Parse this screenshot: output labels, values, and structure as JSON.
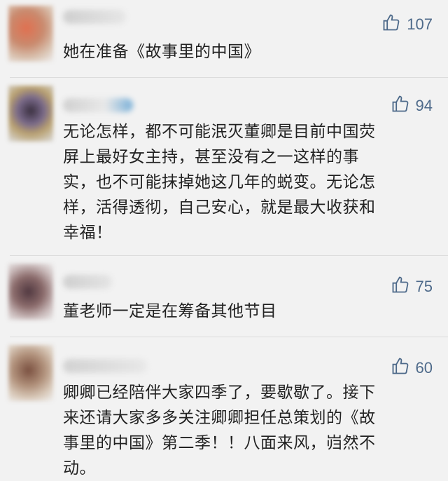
{
  "comments": [
    {
      "likes": "107",
      "text": "她在准备《故事里的中国》",
      "avatar_color": "#c98a6e"
    },
    {
      "likes": "94",
      "text": "无论怎样，都不可能泯灭董卿是目前中国荧\n屏上最好女主持，甚至没有之一这样的事\n实，也不可能抹掉她这几年的蜕变。无论怎\n样，活得透彻，自己安心，就是最大收获和\n幸福！",
      "avatar_color": "#7a6a8a"
    },
    {
      "likes": "75",
      "text": "董老师一定是在筹备其他节目",
      "avatar_color": "#8a6a6a"
    },
    {
      "likes": "60",
      "text": "卿卿已经陪伴大家四季了，要歇歇了。接下\n来还请大家多多关注卿卿担任总策划的《故\n事里的中国》第二季！！八面来风，岿然不\n动。",
      "avatar_color": "#b0907a"
    }
  ]
}
